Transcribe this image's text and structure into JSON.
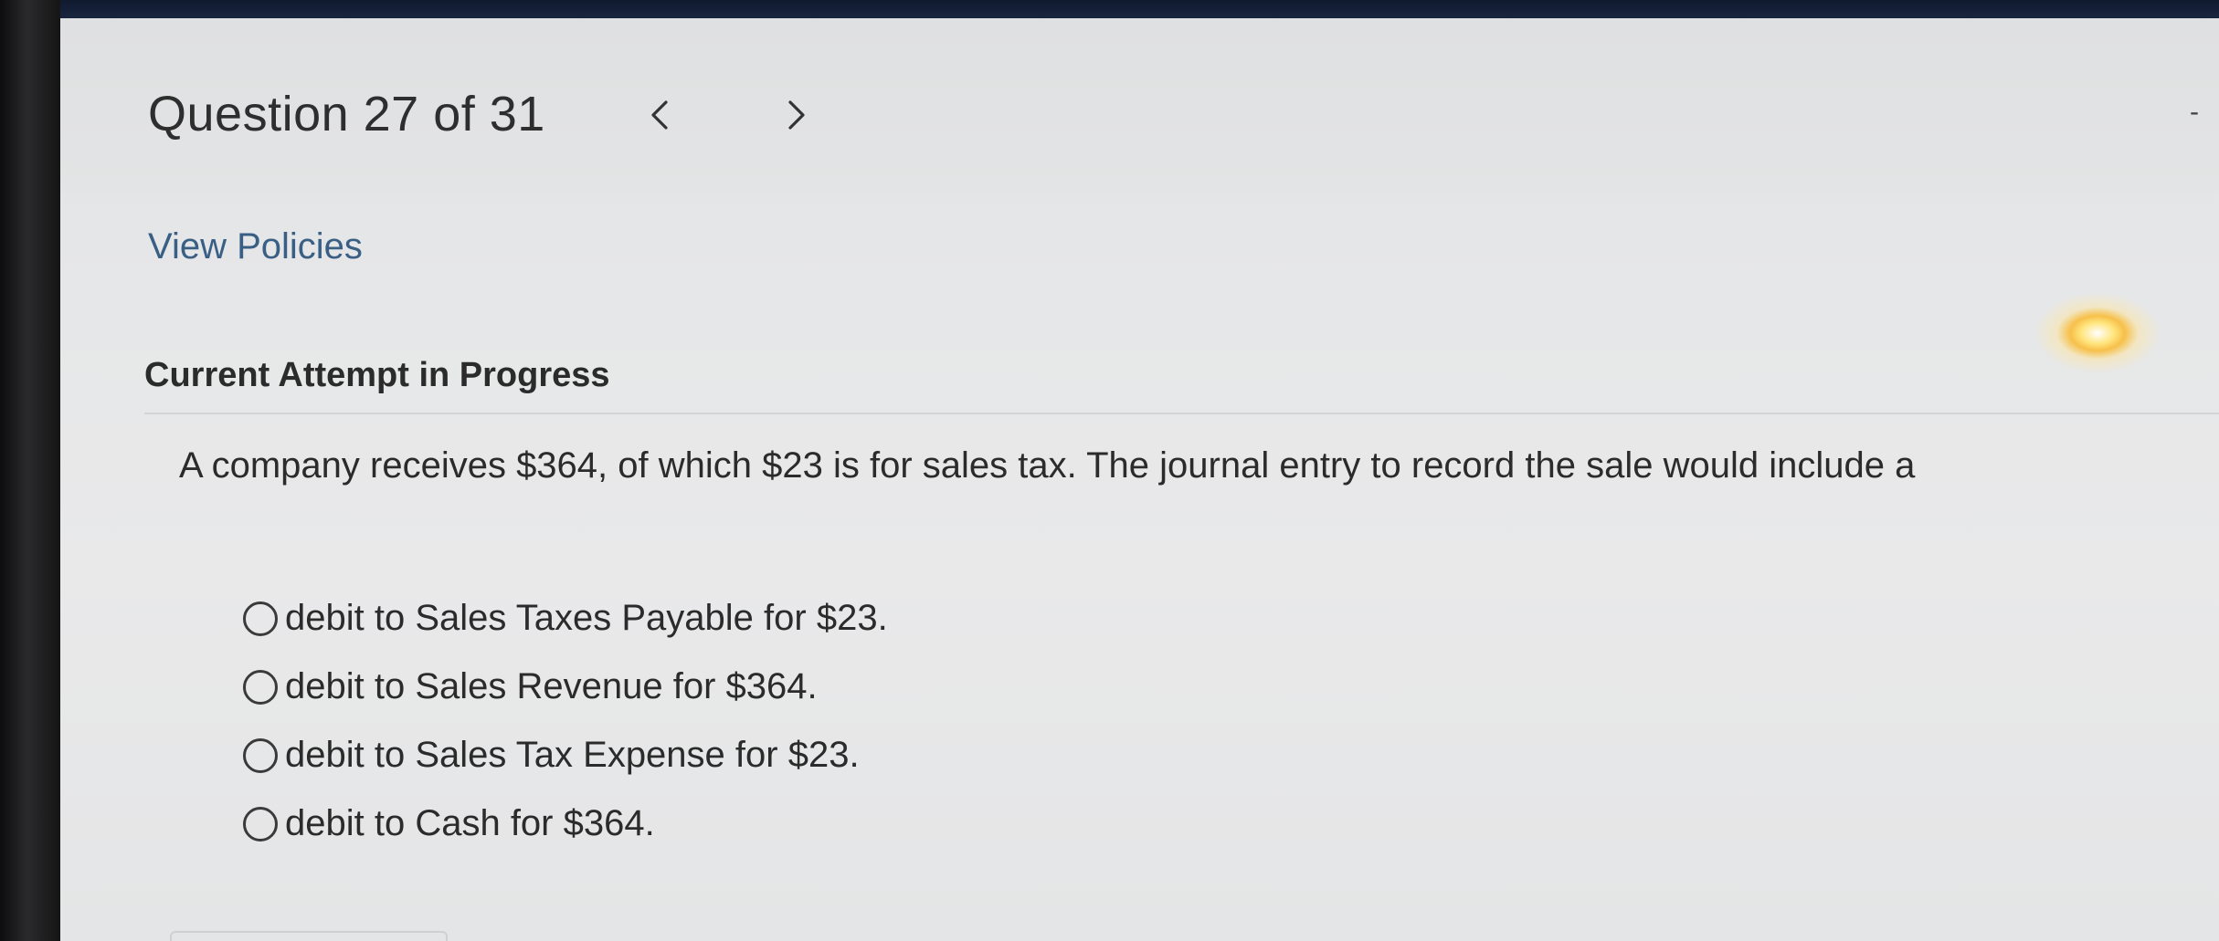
{
  "header": {
    "question_counter": "Question 27 of 31",
    "prev_icon": "chevron-left-icon",
    "next_icon": "chevron-right-icon",
    "corner_mark": "-"
  },
  "links": {
    "view_policies": "View Policies"
  },
  "attempt": {
    "title": "Current Attempt in Progress"
  },
  "question": {
    "text": "A company receives $364, of which $23 is for sales tax. The journal entry to record the sale would include a",
    "options": [
      {
        "label": "debit to Sales Taxes Payable for $23.",
        "selected": false
      },
      {
        "label": "debit to Sales Revenue for $364.",
        "selected": false
      },
      {
        "label": "debit to Sales Tax Expense for $23.",
        "selected": false
      },
      {
        "label": "debit to Cash for $364.",
        "selected": false
      }
    ]
  },
  "colors": {
    "link": "#3a5f84",
    "text": "#2b2b2b",
    "background": "#e6e7e8"
  }
}
